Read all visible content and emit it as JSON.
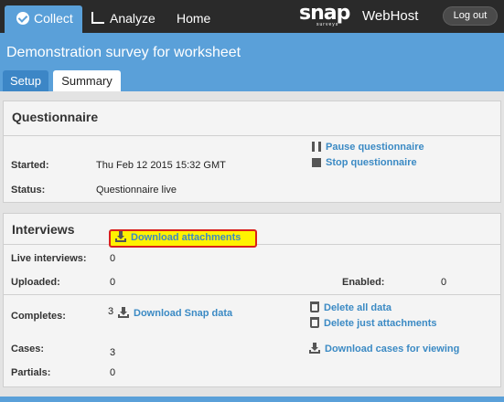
{
  "nav": {
    "collect": "Collect",
    "analyze": "Analyze",
    "home": "Home",
    "logo": "snap",
    "logo_sub": "surveys",
    "product": "WebHost",
    "logout": "Log out"
  },
  "header": {
    "title": "Demonstration survey for worksheet",
    "tabs": [
      "Setup",
      "Summary"
    ]
  },
  "questionnaire": {
    "title": "Questionnaire",
    "started_label": "Started:",
    "started_value": "Thu Feb 12 2015 15:32 GMT",
    "status_label": "Status:",
    "status_value": "Questionnaire live",
    "pause_link": "Pause questionnaire",
    "stop_link": "Stop questionnaire"
  },
  "interviews": {
    "title": "Interviews",
    "live_label": "Live interviews:",
    "live_value": "0",
    "uploaded_label": "Uploaded:",
    "uploaded_value": "0",
    "enabled_label": "Enabled:",
    "enabled_value": "0",
    "completes_label": "Completes:",
    "completes_value": "3",
    "download_snap": "Download Snap data",
    "download_attachments": "Download attachments",
    "delete_all": "Delete all data",
    "delete_attachments": "Delete just attachments",
    "download_cases": "Download cases for viewing",
    "cases_label": "Cases:",
    "cases_value": "3",
    "partials_label": "Partials:",
    "partials_value": "0"
  },
  "colors": {
    "accent": "#5aa0d9",
    "link": "#3b8ac4",
    "highlight": "#fff200",
    "highlight_border": "#d9201c"
  }
}
